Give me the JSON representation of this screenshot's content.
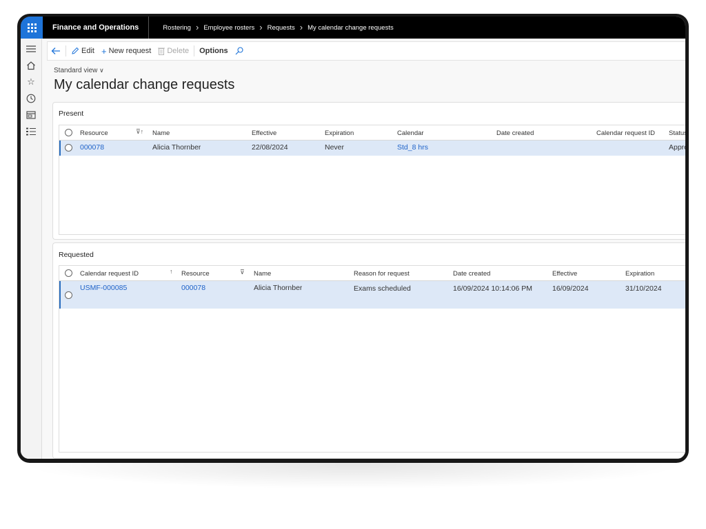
{
  "topbar": {
    "app_title": "Finance and Operations",
    "breadcrumb": [
      "Rostering",
      "Employee rosters",
      "Requests",
      "My calendar change requests"
    ]
  },
  "actions": {
    "back_icon": "back-arrow-icon",
    "edit": "Edit",
    "new_request": "New request",
    "delete": "Delete",
    "options": "Options",
    "search_icon": "search-icon"
  },
  "view": {
    "selector": "Standard view",
    "title": "My calendar change requests"
  },
  "present": {
    "title": "Present",
    "columns": {
      "resource": "Resource",
      "name": "Name",
      "effective": "Effective",
      "expiration": "Expiration",
      "calendar": "Calendar",
      "date_created": "Date created",
      "calendar_request_id": "Calendar request ID",
      "status": "Status"
    },
    "rows": [
      {
        "resource": "000078",
        "name": "Alicia Thornber",
        "effective": "22/08/2024",
        "expiration": "Never",
        "calendar": "Std_8 hrs",
        "date_created": "",
        "calendar_request_id": "",
        "status": "Approved"
      }
    ]
  },
  "requested": {
    "title": "Requested",
    "columns": {
      "calendar_request_id": "Calendar request ID",
      "resource": "Resource",
      "name": "Name",
      "reason": "Reason for request",
      "date_created": "Date created",
      "effective": "Effective",
      "expiration": "Expiration"
    },
    "rows": [
      {
        "calendar_request_id": "USMF-000085",
        "resource": "000078",
        "name": "Alicia Thornber",
        "reason": "Exams scheduled",
        "date_created": "16/09/2024 10:14:06 PM",
        "effective": "16/09/2024",
        "expiration": "31/10/2024"
      }
    ]
  },
  "colors": {
    "accent": "#1e74d9",
    "selected_row": "#dde8f7",
    "link": "#1e62c8",
    "topbar": "#000000"
  }
}
